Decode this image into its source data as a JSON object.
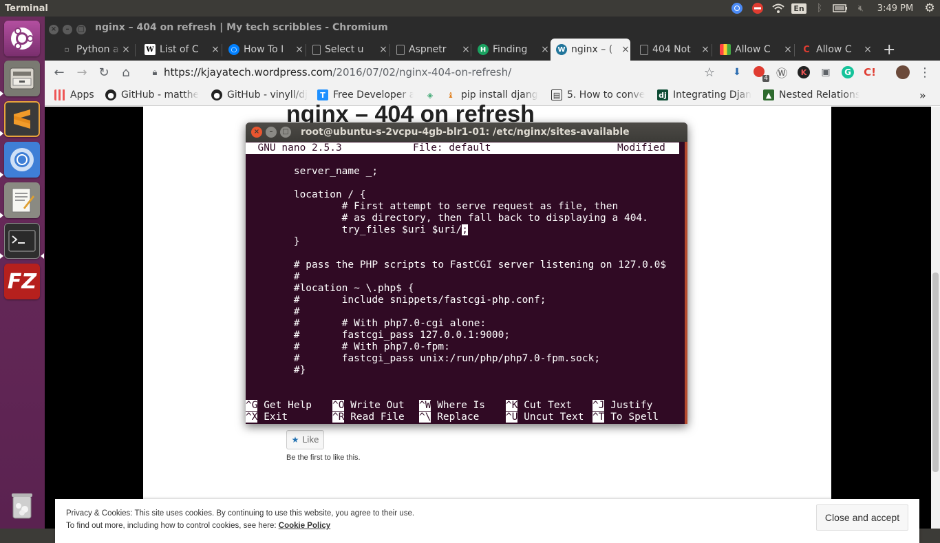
{
  "topbar": {
    "app_title": "Terminal",
    "time": "3:49 PM",
    "lang": "En"
  },
  "window": {
    "title": "nginx – 404 on refresh | My tech scribbles - Chromium"
  },
  "tabs": [
    {
      "label": "Python a"
    },
    {
      "label": "List of C"
    },
    {
      "label": "How To I"
    },
    {
      "label": "Select u"
    },
    {
      "label": "Aspnetr"
    },
    {
      "label": "Finding"
    },
    {
      "label": "nginx – ("
    },
    {
      "label": "404 Not"
    },
    {
      "label": "Allow C"
    },
    {
      "label": "Allow C"
    }
  ],
  "toolbar": {
    "url_host": "https://kjayatech.wordpress.com",
    "url_path": "/2016/07/02/nginx-404-on-refresh/",
    "ext_badge": "4"
  },
  "bookmarks": [
    {
      "label": "Apps"
    },
    {
      "label": "GitHub - matthe"
    },
    {
      "label": "GitHub - vinyll/dj"
    },
    {
      "label": "Free Developer a"
    },
    {
      "label": ""
    },
    {
      "label": "pip install djang"
    },
    {
      "label": "5. How to conve"
    },
    {
      "label": "Integrating Djan"
    },
    {
      "label": "Nested Relations"
    },
    {
      "label": "»"
    }
  ],
  "page": {
    "heading": "nginx – 404 on refresh",
    "like_label": "Like",
    "like_first": "Be the first to like this.",
    "cookie_line1": "Privacy & Cookies: This site uses cookies. By continuing to use this website, you agree to their use.",
    "cookie_line2_prefix": "To find out more, including how to control cookies, see here: ",
    "cookie_link": "Cookie Policy",
    "cookie_button": "Close and accept"
  },
  "terminal": {
    "title": "root@ubuntu-s-2vcpu-4gb-blr1-01: /etc/nginx/sites-available",
    "nano_version": "  GNU nano 2.5.3",
    "nano_file": "File: default",
    "nano_status": "Modified ",
    "lines": [
      "",
      "        server_name _;",
      "",
      "        location / {",
      "                # First attempt to serve request as file, then",
      "                # as directory, then fall back to displaying a 404.",
      "                try_files $uri $uri/",
      "        }",
      "",
      "        # pass the PHP scripts to FastCGI server listening on 127.0.0$",
      "        #",
      "        #location ~ \\.php$ {",
      "        #       include snippets/fastcgi-php.conf;",
      "        #",
      "        #       # With php7.0-cgi alone:",
      "        #       fastcgi_pass 127.0.0.1:9000;",
      "        #       # With php7.0-fpm:",
      "        #       fastcgi_pass unix:/run/php/php7.0-fpm.sock;",
      "        #}"
    ],
    "cursor_char": ";",
    "shortcuts_row1": [
      {
        "key": "^G",
        "label": "Get Help"
      },
      {
        "key": "^O",
        "label": "Write Out"
      },
      {
        "key": "^W",
        "label": "Where Is"
      },
      {
        "key": "^K",
        "label": "Cut Text"
      },
      {
        "key": "^J",
        "label": "Justify"
      }
    ],
    "shortcuts_row2": [
      {
        "key": "^X",
        "label": "Exit"
      },
      {
        "key": "^R",
        "label": "Read File"
      },
      {
        "key": "^\\",
        "label": "Replace"
      },
      {
        "key": "^U",
        "label": "Uncut Text"
      },
      {
        "key": "^T",
        "label": "To Spell"
      }
    ]
  }
}
